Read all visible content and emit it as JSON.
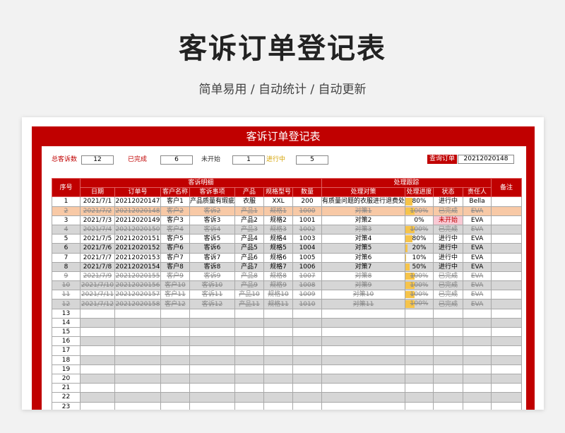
{
  "page": {
    "title": "客诉订单登记表",
    "subtitle": "简单易用 / 自动统计 / 自动更新"
  },
  "sheet": {
    "title": "客诉订单登记表",
    "stats": [
      {
        "label": "总客诉数",
        "value": "12",
        "color": "#c00000"
      },
      {
        "label": "已完成",
        "value": "6",
        "color": "#c00000"
      },
      {
        "label": "未开始",
        "value": "1",
        "color": "#333333"
      },
      {
        "label": "进行中",
        "value": "5",
        "color": "#d4a200"
      }
    ],
    "query": {
      "label": "查询订单",
      "value": "20212020148"
    },
    "group_headers": {
      "seq": "序号",
      "detail": "客诉明细",
      "track": "处理跟踪",
      "remark": "备注"
    },
    "columns": [
      "日期",
      "订单号",
      "客户名称",
      "客诉事项",
      "产品",
      "规格型号",
      "数量",
      "处理对策",
      "处理进度",
      "状态",
      "责任人"
    ],
    "rows": [
      {
        "seq": "1",
        "date": "2021/7/1",
        "order": "20212020147",
        "customer": "客户1",
        "issue": "产品质量有瑕疵",
        "product": "衣服",
        "spec": "XXL",
        "qty": "200",
        "measure": "有质量问题的衣服进行退费处",
        "progress": "80%",
        "progress_value": 0.8,
        "status": "进行中",
        "owner": "Bella",
        "kind": "active"
      },
      {
        "seq": "2",
        "date": "2021/7/2",
        "order": "20212020148",
        "customer": "客户2",
        "issue": "客诉2",
        "product": "产品1",
        "spec": "规格1",
        "qty": "1000",
        "measure": "对策1",
        "progress": "100%",
        "progress_value": 1.0,
        "status": "已完成",
        "owner": "EVA",
        "kind": "hl-done"
      },
      {
        "seq": "3",
        "date": "2021/7/3",
        "order": "20212020149",
        "customer": "客户3",
        "issue": "客诉3",
        "product": "产品2",
        "spec": "规格2",
        "qty": "1001",
        "measure": "对策2",
        "progress": "0%",
        "progress_value": 0.0,
        "status": "未开始",
        "owner": "EVA",
        "kind": "notstarted"
      },
      {
        "seq": "4",
        "date": "2021/7/4",
        "order": "20212020150",
        "customer": "客户4",
        "issue": "客诉4",
        "product": "产品3",
        "spec": "规格3",
        "qty": "1002",
        "measure": "对策3",
        "progress": "100%",
        "progress_value": 1.0,
        "status": "已完成",
        "owner": "EVA",
        "kind": "done"
      },
      {
        "seq": "5",
        "date": "2021/7/5",
        "order": "20212020151",
        "customer": "客户5",
        "issue": "客诉5",
        "product": "产品4",
        "spec": "规格4",
        "qty": "1003",
        "measure": "对策4",
        "progress": "80%",
        "progress_value": 0.8,
        "status": "进行中",
        "owner": "EVA",
        "kind": "active"
      },
      {
        "seq": "6",
        "date": "2021/7/6",
        "order": "20212020152",
        "customer": "客户6",
        "issue": "客诉6",
        "product": "产品5",
        "spec": "规格5",
        "qty": "1004",
        "measure": "对策5",
        "progress": "20%",
        "progress_value": 0.2,
        "status": "进行中",
        "owner": "EVA",
        "kind": "active"
      },
      {
        "seq": "7",
        "date": "2021/7/7",
        "order": "20212020153",
        "customer": "客户7",
        "issue": "客诉7",
        "product": "产品6",
        "spec": "规格6",
        "qty": "1005",
        "measure": "对策6",
        "progress": "10%",
        "progress_value": 0.1,
        "status": "进行中",
        "owner": "EVA",
        "kind": "active"
      },
      {
        "seq": "8",
        "date": "2021/7/8",
        "order": "20212020154",
        "customer": "客户8",
        "issue": "客诉8",
        "product": "产品7",
        "spec": "规格7",
        "qty": "1006",
        "measure": "对策7",
        "progress": "50%",
        "progress_value": 0.5,
        "status": "进行中",
        "owner": "EVA",
        "kind": "active"
      },
      {
        "seq": "9",
        "date": "2021/7/9",
        "order": "20212020155",
        "customer": "客户9",
        "issue": "客诉9",
        "product": "产品8",
        "spec": "规格8",
        "qty": "1007",
        "measure": "对策8",
        "progress": "100%",
        "progress_value": 1.0,
        "status": "已完成",
        "owner": "EVA",
        "kind": "done"
      },
      {
        "seq": "10",
        "date": "2021/7/10",
        "order": "20212020156",
        "customer": "客户10",
        "issue": "客诉10",
        "product": "产品9",
        "spec": "规格9",
        "qty": "1008",
        "measure": "对策9",
        "progress": "100%",
        "progress_value": 1.0,
        "status": "已完成",
        "owner": "EVA",
        "kind": "done"
      },
      {
        "seq": "11",
        "date": "2021/7/11",
        "order": "20212020157",
        "customer": "客户11",
        "issue": "客诉11",
        "product": "产品10",
        "spec": "规格10",
        "qty": "1009",
        "measure": "对策10",
        "progress": "100%",
        "progress_value": 1.0,
        "status": "已完成",
        "owner": "EVA",
        "kind": "done"
      },
      {
        "seq": "12",
        "date": "2021/7/12",
        "order": "20212020158",
        "customer": "客户12",
        "issue": "客诉12",
        "product": "产品11",
        "spec": "规格11",
        "qty": "1010",
        "measure": "对策11",
        "progress": "100%",
        "progress_value": 1.0,
        "status": "已完成",
        "owner": "EVA",
        "kind": "done"
      }
    ],
    "empty_rows": [
      "13",
      "14",
      "15",
      "16",
      "17",
      "18",
      "19",
      "20",
      "21",
      "22",
      "23"
    ]
  }
}
